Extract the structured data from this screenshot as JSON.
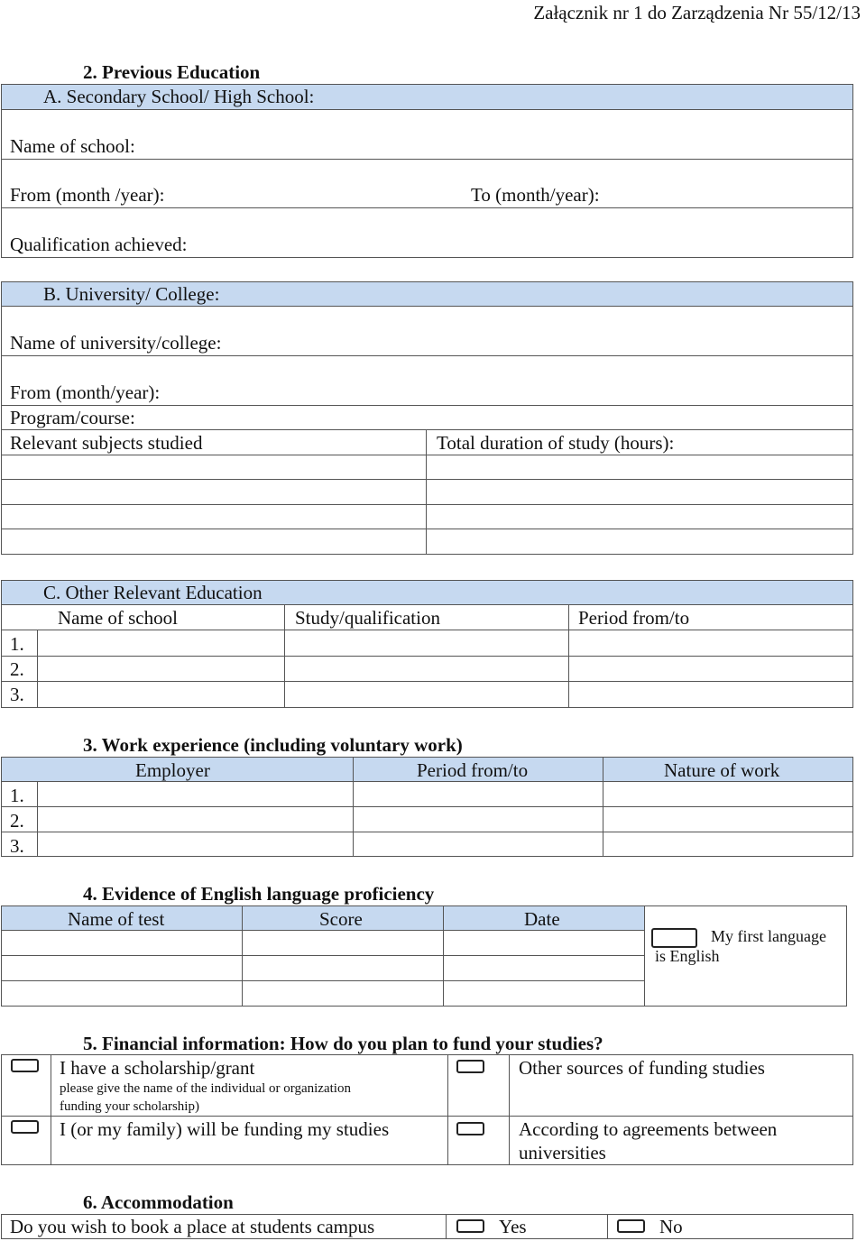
{
  "header": {
    "annex": "Załącznik nr 1 do Zarządzenia Nr 55/12/13"
  },
  "section2": {
    "title": "2.  Previous Education",
    "A": {
      "title": "A.  Secondary School/ High School:",
      "name_of_school": "Name of school:",
      "from": "From (month /year):",
      "to": "To (month/year):",
      "qualification": "Qualification achieved:"
    },
    "B": {
      "title": "B.  University/ College:",
      "name_of_university": "Name of university/college:",
      "from": "From (month/year):",
      "program": "Program/course:",
      "subjects": "Relevant subjects studied",
      "duration": "Total duration of study (hours):"
    },
    "C": {
      "title": "C.  Other Relevant Education",
      "columns": [
        "Name of school",
        "Study/qualification",
        "Period from/to"
      ],
      "rows": [
        "1.",
        "2.",
        "3."
      ]
    }
  },
  "section3": {
    "title": "3.  Work experience (including voluntary work)",
    "columns": [
      "Employer",
      "Period from/to",
      "Nature of work"
    ],
    "rows": [
      "1.",
      "2.",
      "3."
    ]
  },
  "section4": {
    "title": "4.  Evidence of English language proficiency",
    "columns": [
      "Name of test",
      "Score",
      "Date"
    ],
    "first_language_line1": "My first language",
    "first_language_line2": "is English",
    "first_language_checked": false
  },
  "section5": {
    "title": "5.  Financial information: How do you plan to fund your studies?",
    "options": {
      "scholarship": "I have a scholarship/grant",
      "scholarship_note1": "please give the name of the individual or organization",
      "scholarship_note2": "funding your scholarship)",
      "other_sources": "Other sources of funding studies",
      "family": "I (or my family) will be funding my studies",
      "agreements1": "According to agreements between",
      "agreements2": "universities"
    }
  },
  "section6": {
    "title": "6.  Accommodation",
    "question": "Do you wish to book a place at students campus",
    "yes": "Yes",
    "no": "No"
  }
}
